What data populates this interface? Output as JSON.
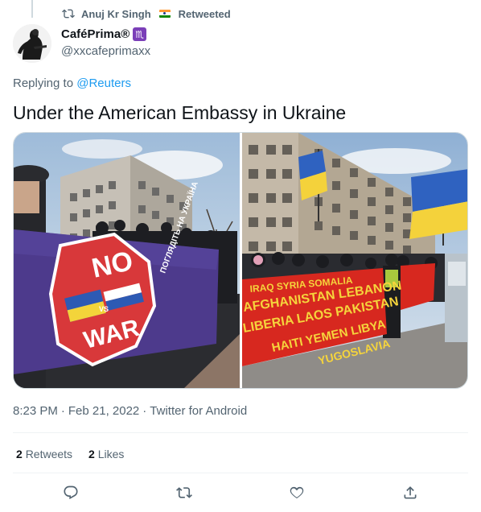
{
  "retweet": {
    "label": "Anuj Kr Singh",
    "suffix": "Retweeted"
  },
  "author": {
    "name": "CaféPrima®",
    "badge": "♏",
    "handle": "@xxcafeprimaxx"
  },
  "reply": {
    "prefix": "Replying to",
    "mention": "@Reuters"
  },
  "tweet": {
    "text": "Under the American Embassy in Ukraine"
  },
  "photos": {
    "left_banner": {
      "no": "NO",
      "war": "WAR",
      "vs": "VS",
      "side_text": "ПОГЛЯДІТЬ НА УКРАЇНА"
    },
    "right_banner": {
      "line1": "IRAQ SYRIA SOMALIA",
      "line2": "AFGHANISTAN LEBANON",
      "line3": "LIBERIA LAOS PAKISTAN",
      "line4": "HAITI YEMEN LIBYA",
      "line5": "YUGOSLAVIA"
    }
  },
  "meta": {
    "time": "8:23 PM",
    "date": "Feb 21, 2022",
    "source": "Twitter for Android",
    "sep": "·"
  },
  "stats": {
    "retweets_count": "2",
    "retweets_label": "Retweets",
    "likes_count": "2",
    "likes_label": "Likes"
  },
  "icons": [
    "retweet-icon",
    "reply-icon",
    "retweet-action-icon",
    "like-icon",
    "share-icon"
  ],
  "colors": {
    "link": "#1d9bf0",
    "secondary": "#536471",
    "text": "#0f1419",
    "divider": "#eff3f4"
  }
}
